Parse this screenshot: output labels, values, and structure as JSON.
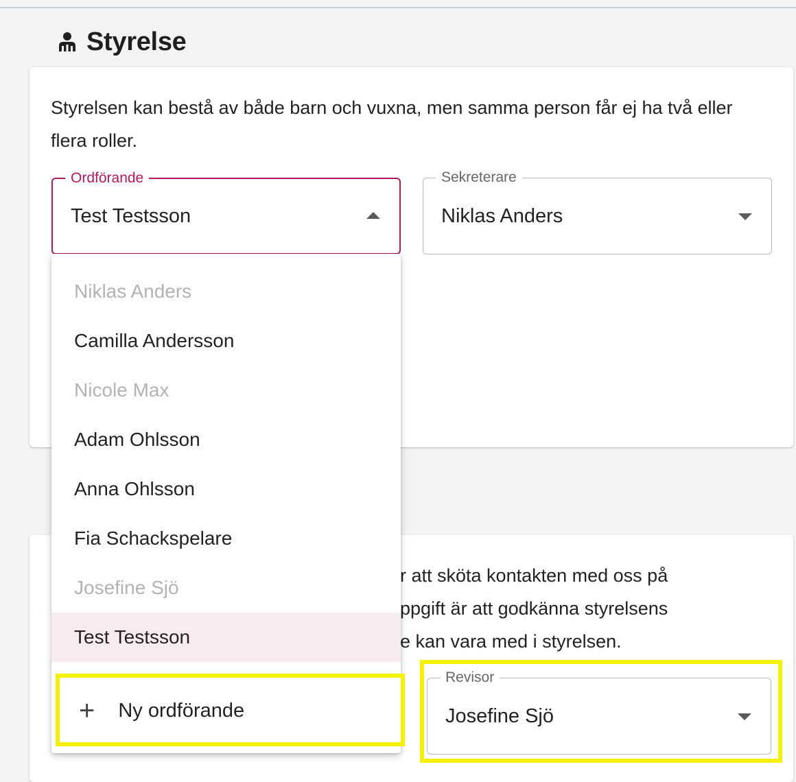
{
  "section": {
    "icon": "board-members-icon",
    "title": "Styrelse"
  },
  "board_card": {
    "description": "Styrelsen kan bestå av både barn och vuxna, men samma person får ej ha två eller flera roller."
  },
  "fields": {
    "ordforande": {
      "label": "Ordförande",
      "value": "Test Testsson",
      "state": "open"
    },
    "sekreterare": {
      "label": "Sekreterare",
      "value": "Niklas Anders",
      "state": "closed"
    },
    "revisor": {
      "label": "Revisor",
      "value": "Josefine Sjö",
      "state": "closed"
    }
  },
  "auditor_card": {
    "description_fragment_lines": [
      "r att sköta kontakten med oss på",
      "ppgift är att godkänna styrelsens",
      "e kan vara med i styrelsen."
    ]
  },
  "dropdown": {
    "options": [
      {
        "label": "Niklas Anders",
        "disabled": true,
        "selected": false
      },
      {
        "label": "Camilla Andersson",
        "disabled": false,
        "selected": false
      },
      {
        "label": "Nicole Max",
        "disabled": true,
        "selected": false
      },
      {
        "label": "Adam Ohlsson",
        "disabled": false,
        "selected": false
      },
      {
        "label": "Anna Ohlsson",
        "disabled": false,
        "selected": false
      },
      {
        "label": "Fia Schackspelare",
        "disabled": false,
        "selected": false
      },
      {
        "label": "Josefine Sjö",
        "disabled": true,
        "selected": false
      },
      {
        "label": "Test Testsson",
        "disabled": false,
        "selected": true
      }
    ],
    "new_option_label": "Ny ordförande",
    "new_option_icon": "plus-icon"
  },
  "colors": {
    "accent": "#b5175d",
    "selected_bg": "#f7ebf0",
    "disabled_text": "#b3b3b3",
    "highlight": "#f5f200"
  }
}
